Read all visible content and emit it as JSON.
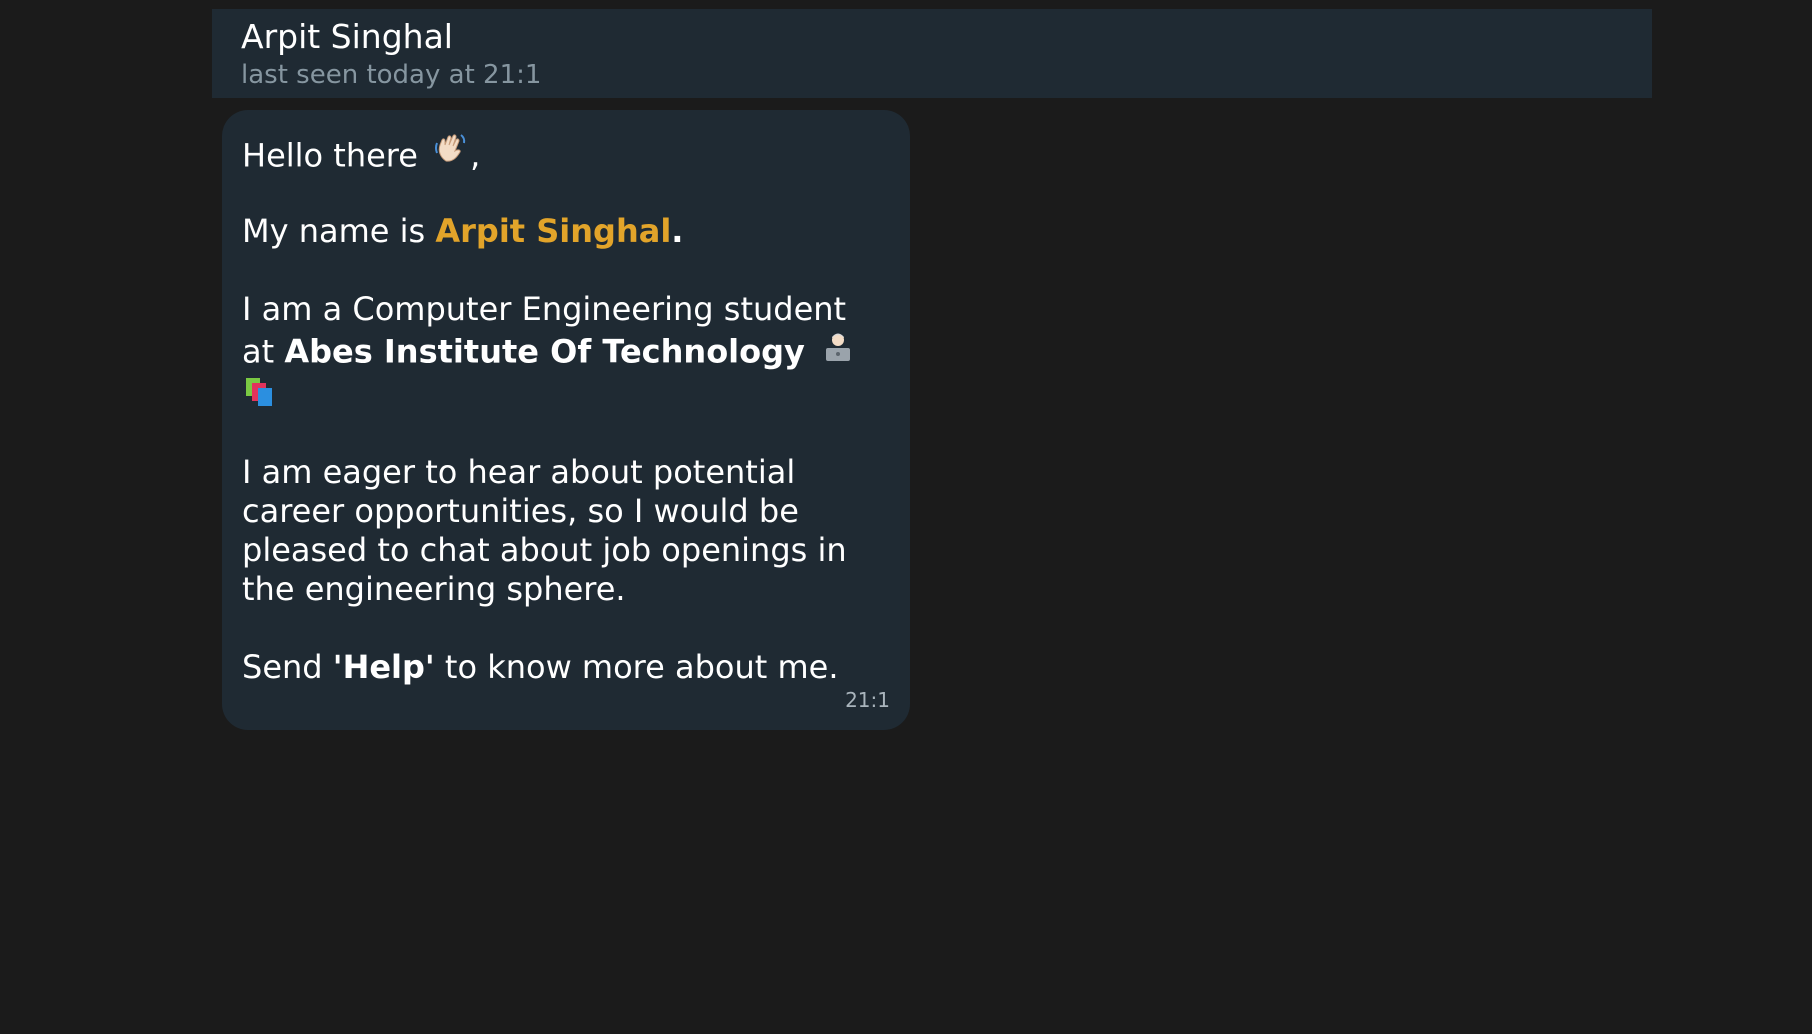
{
  "header": {
    "contact_name": "Arpit Singhal",
    "status": "last seen today at 21:1"
  },
  "message": {
    "greeting": "Hello there",
    "greeting_suffix": ",",
    "name_prefix": "My name is",
    "name": "Arpit Singhal",
    "name_suffix": ".",
    "study_line1": "I am a Computer Engineering student",
    "study_prefix": "at",
    "institute": "Abes Institute Of Technology",
    "eager_line1": "I am eager to hear about potential",
    "eager_line2": "career opportunities, so I would be",
    "eager_line3": "pleased to chat about job openings in",
    "eager_line4": "the engineering sphere.",
    "send_prefix": "Send",
    "send_keyword": "'Help'",
    "send_suffix": "to know more about me.",
    "timestamp": "21:1",
    "icons": [
      "waving-hand-icon",
      "technologist-icon",
      "books-icon"
    ]
  },
  "colors": {
    "background": "#1b1b1b",
    "panel": "#1f2a33",
    "accent": "#e2a42a",
    "muted": "#8696a0"
  }
}
